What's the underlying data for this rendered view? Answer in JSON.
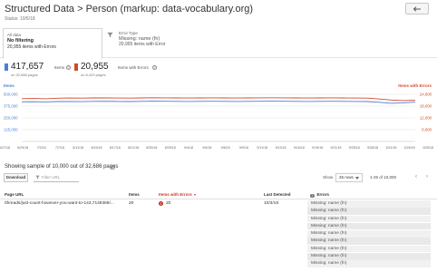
{
  "header": {
    "title": "Structured Data > Person (markup: data-vocabulary.org)",
    "status": "Status: 10/5/18"
  },
  "filters": {
    "all_data": {
      "label": "All data",
      "value": "No filtering",
      "sub": "20,955 items with Errors"
    },
    "error_type": {
      "label": "Error Type",
      "value": "Missing: name (fn)",
      "sub": "20,955 items with Error"
    }
  },
  "stats": {
    "items": {
      "value": "417,657",
      "label": "Items",
      "sub": "on 32,686 pages",
      "color": "#4a7fd6"
    },
    "errors": {
      "value": "20,955",
      "label": "Items with Errors",
      "sub": "on 8,420 pages",
      "color": "#d14a2b"
    }
  },
  "chart_data": {
    "type": "line",
    "left_axis_title": "Items",
    "right_axis_title": "Items with Errors",
    "left_ticks": [
      "500,000",
      "375,000",
      "250,000",
      "125,000"
    ],
    "right_ticks": [
      "24,000",
      "18,000",
      "12,000",
      "6,000"
    ],
    "left_ylim": [
      0,
      500000
    ],
    "right_ylim": [
      0,
      24000
    ],
    "x": [
      "6/27/18",
      "6/29/18",
      "7/2/18",
      "7/5/18",
      "7/8/18",
      "7/11/18",
      "7/14/18",
      "7/17/18",
      "7/20/18",
      "7/23/18",
      "7/26/18",
      "7/29/18",
      "8/1/18",
      "8/4/18",
      "8/7/18",
      "8/10/18",
      "8/13/18",
      "8/16/18",
      "8/19/18",
      "8/22/18",
      "8/25/18",
      "8/28/18",
      "8/31/18",
      "9/3/18",
      "9/6/18",
      "9/9/18",
      "9/12/18",
      "9/15/18",
      "9/18/18",
      "9/21/18",
      "9/24/18",
      "9/27/18",
      "9/30/18",
      "10/3/18"
    ],
    "x_tick_labels": [
      "6/27/18",
      "6/29/18",
      "7/3/18",
      "7/7/18",
      "8/11/18",
      "8/15/18",
      "8/17/18",
      "8/21/18",
      "8/25/18",
      "8/29/18",
      "9/4/18",
      "9/5/18",
      "9/8/18",
      "9/9/18",
      "9/11/18",
      "9/13/18",
      "9/16/18",
      "9/19/18",
      "9/21/18",
      "9/25/18",
      "9/28/18",
      "10/1/18",
      "10/4/18",
      "10/5/18"
    ],
    "series": [
      {
        "name": "Items",
        "axis": "left",
        "color": "#4a7fd6",
        "values": [
          420000,
          421000,
          419000,
          423000,
          424000,
          422000,
          425000,
          426000,
          424000,
          423000,
          425000,
          427000,
          426000,
          425000,
          424000,
          425000,
          426000,
          425000,
          424000,
          425000,
          426000,
          427000,
          426000,
          425000,
          424000,
          425000,
          426000,
          425000,
          424000,
          423000,
          415000,
          405000,
          410000,
          417657
        ]
      },
      {
        "name": "Items with Errors",
        "axis": "right",
        "color": "#d14a2b",
        "values": [
          21800,
          21900,
          21750,
          22000,
          22100,
          22050,
          22150,
          22200,
          22100,
          22050,
          22150,
          22250,
          22200,
          22150,
          22100,
          22150,
          22200,
          22150,
          22100,
          22150,
          22200,
          22250,
          22200,
          22150,
          22100,
          22150,
          22200,
          22150,
          22100,
          22050,
          21600,
          21100,
          20800,
          20955
        ]
      }
    ]
  },
  "table": {
    "sample_text": "Showing sample of 10,000 out of 32,686 pages",
    "download_label": "Download",
    "filter_placeholder": "Filter URL",
    "show_label": "Show",
    "rows_value": "25 rows",
    "range_text": "1-25 of 10,000",
    "columns": [
      "Page URL",
      "Items",
      "Items with Errors",
      "Last Detected",
      "Errors"
    ],
    "row": {
      "url": "/threads/just-count-however-you-want-to-143,7148369/...",
      "items": "20",
      "errors": "20",
      "last_detected": "10/3/18",
      "error_messages": [
        "Missing: name (fn)",
        "Missing: name (fn)",
        "Missing: name (fn)",
        "Missing: name (fn)",
        "Missing: name (fn)",
        "Missing: name (fn)",
        "Missing: name (fn)",
        "Missing: name (fn)",
        "Missing: name (fn)"
      ]
    }
  }
}
